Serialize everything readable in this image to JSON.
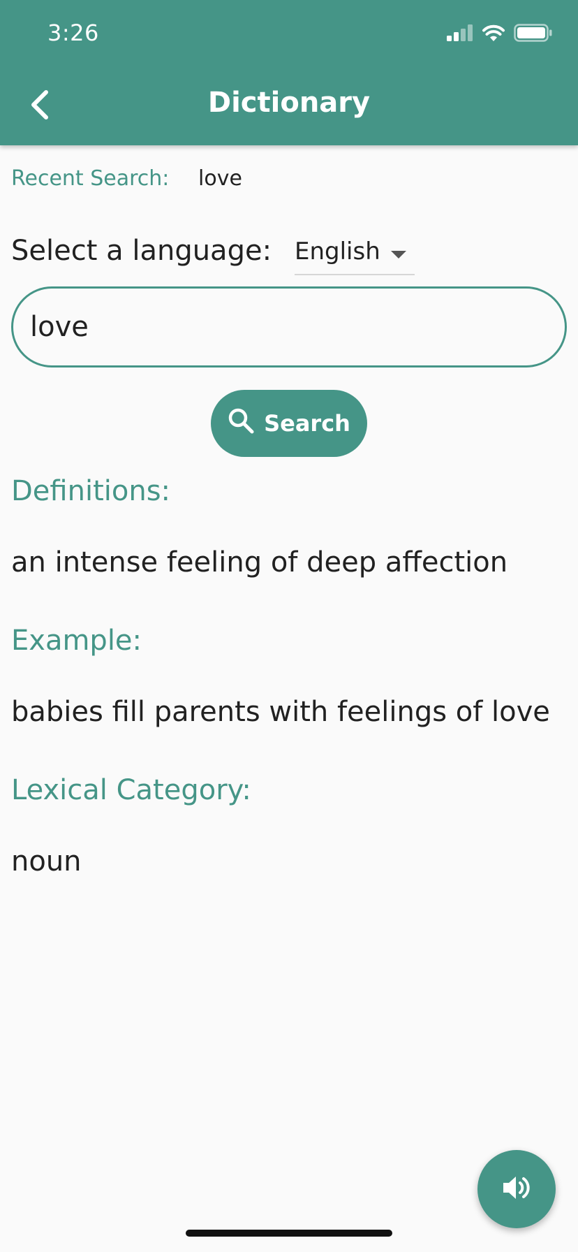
{
  "status_bar": {
    "time": "3:26"
  },
  "appbar": {
    "title": "Dictionary",
    "back_icon": "chevron-left-icon"
  },
  "recent_search": {
    "label": "Recent Search:",
    "value": "love"
  },
  "language": {
    "label": "Select a language:",
    "selected": "English"
  },
  "search": {
    "input_value": "love",
    "button_label": "Search",
    "button_icon": "search-icon"
  },
  "results": {
    "definitions_heading": "Definitions:",
    "definition": "an intense feeling of deep affection",
    "example_heading": "Example:",
    "example": "babies fill parents with feelings of love",
    "lexical_heading": "Lexical Category:",
    "lexical_category": "noun"
  },
  "fab": {
    "icon": "speaker-icon"
  },
  "colors": {
    "primary": "#459587",
    "text": "#212121",
    "background": "#fafafa"
  }
}
